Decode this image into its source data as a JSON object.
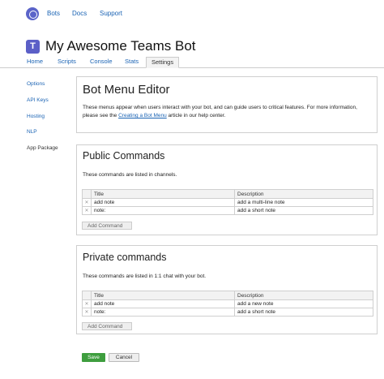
{
  "topnav": {
    "links": [
      "Bots",
      "Docs",
      "Support"
    ]
  },
  "header": {
    "icon_letter": "T",
    "title": "My Awesome Teams Bot"
  },
  "tabs": [
    {
      "label": "Home"
    },
    {
      "label": "Scripts"
    },
    {
      "label": "Console"
    },
    {
      "label": "Stats"
    },
    {
      "label": "Settings",
      "active": true
    }
  ],
  "sidebar": {
    "items": [
      "Options",
      "API Keys",
      "Hosting",
      "NLP",
      "App Package"
    ]
  },
  "editor": {
    "title": "Bot Menu Editor",
    "desc_part1": "These menus appear when users interact with your bot, and can guide users to critical features. For more information, please see the ",
    "desc_link": "Creating a Bot Menu",
    "desc_part2": " article in our help center."
  },
  "public": {
    "title": "Public Commands",
    "desc": "These commands are listed in channels.",
    "col_title": "Title",
    "col_desc": "Description",
    "rows": [
      {
        "title": "add note",
        "description": "add a multi-line note"
      },
      {
        "title": "note:",
        "description": "add a short note"
      }
    ],
    "add_label": "Add Command"
  },
  "private": {
    "title": "Private commands",
    "desc": "These commands are listed in 1:1 chat with your bot.",
    "col_title": "Title",
    "col_desc": "Description",
    "rows": [
      {
        "title": "add note",
        "description": "add a new note"
      },
      {
        "title": "note:",
        "description": "add a short note"
      }
    ],
    "add_label": "Add Command"
  },
  "actions": {
    "save_label": "Save",
    "cancel_label": "Cancel"
  },
  "colors": {
    "link": "#1a63b4",
    "save": "#3e9e3e",
    "teams": "#5b5fc7"
  }
}
